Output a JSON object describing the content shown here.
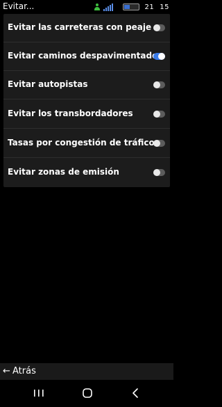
{
  "status_bar": {
    "title": "Evitar...",
    "icons": [
      "person-icon",
      "signal-icon",
      "battery-icon"
    ],
    "clock_hour": "21",
    "clock_minute": "15"
  },
  "settings": {
    "rows": [
      {
        "label": "Evitar las carreteras con peaje",
        "enabled": false
      },
      {
        "label": "Evitar caminos despavimentados",
        "enabled": true
      },
      {
        "label": "Evitar autopistas",
        "enabled": false
      },
      {
        "label": "Evitar los transbordadores",
        "enabled": false
      },
      {
        "label": "Tasas por congestión de tráfico",
        "enabled": false
      },
      {
        "label": "Evitar zonas de emisión",
        "enabled": false
      }
    ]
  },
  "back_bar": {
    "arrow": "←",
    "label": "Atrás"
  },
  "nav_bar": {
    "buttons": [
      "recents-icon",
      "home-icon",
      "back-icon"
    ]
  },
  "colors": {
    "accent": "#3a7be8",
    "card_background": "#1c1c1c",
    "page_background": "#000000"
  }
}
